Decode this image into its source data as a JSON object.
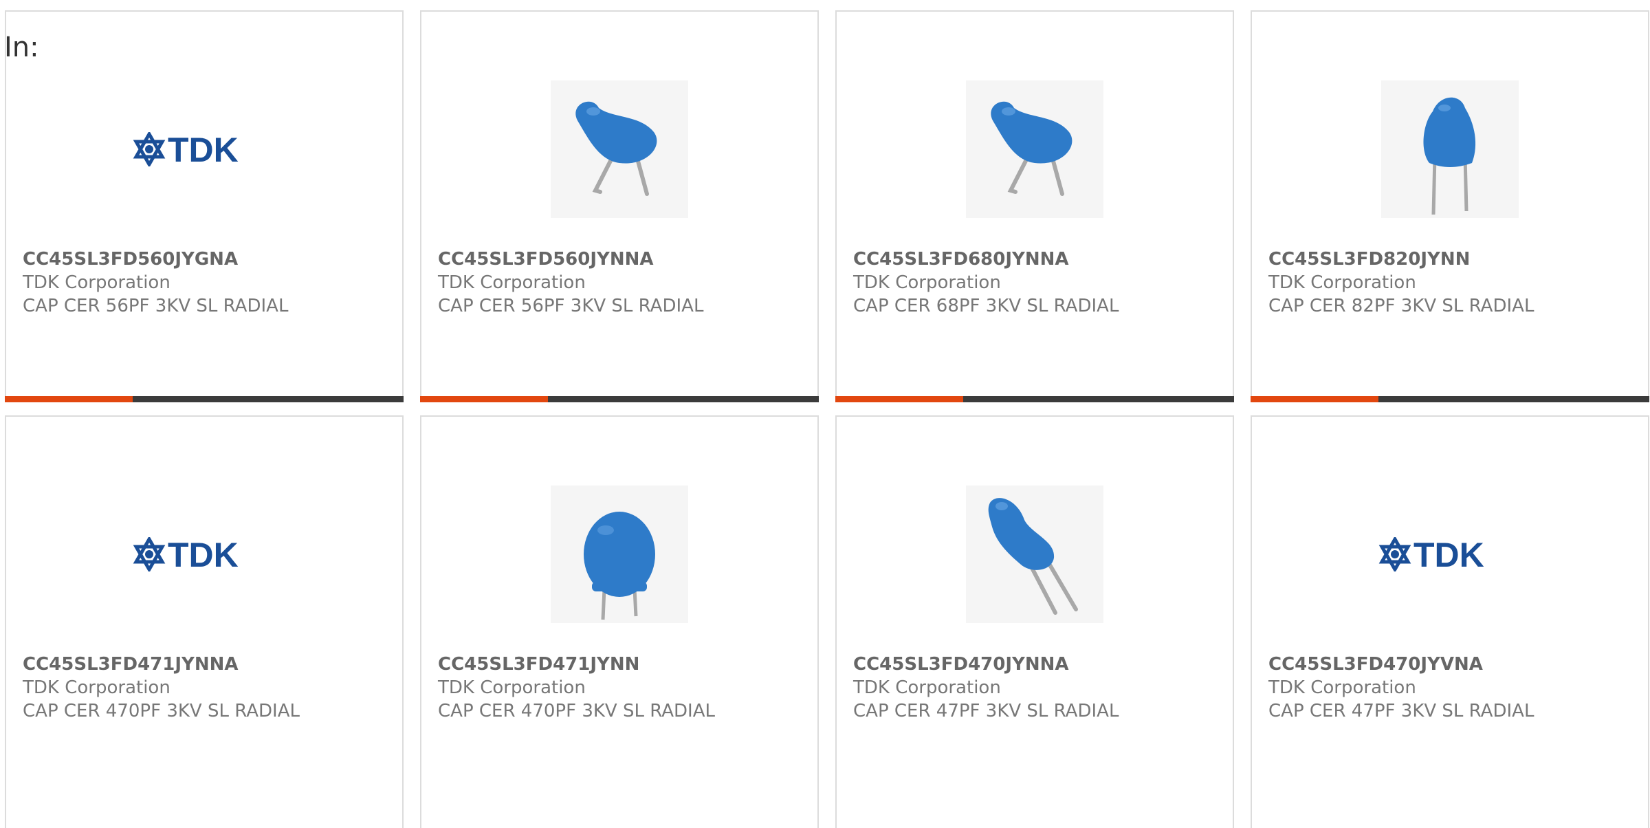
{
  "header": {
    "label": "In:"
  },
  "colors": {
    "accent": "#e2470f",
    "bar": "#3b3b3b",
    "capacitor_blue": "#2e7bc9",
    "logo_blue": "#1a4e97"
  },
  "products": [
    {
      "part": "CC45SL3FD560JYGNA",
      "mfr": "TDK Corporation",
      "desc": "CAP CER 56PF 3KV SL RADIAL",
      "image": "tdk-logo",
      "progress": 0.32
    },
    {
      "part": "CC45SL3FD560JYNNA",
      "mfr": "TDK Corporation",
      "desc": "CAP CER 56PF 3KV SL RADIAL",
      "image": "capacitor-bent-lead-icon",
      "progress": 0.32
    },
    {
      "part": "CC45SL3FD680JYNNA",
      "mfr": "TDK Corporation",
      "desc": "CAP CER 68PF 3KV SL RADIAL",
      "image": "capacitor-bent-lead-icon",
      "progress": 0.32
    },
    {
      "part": "CC45SL3FD820JYNN",
      "mfr": "TDK Corporation",
      "desc": "CAP CER 82PF 3KV SL RADIAL",
      "image": "capacitor-straight-lead-icon",
      "progress": 0.32
    },
    {
      "part": "CC45SL3FD471JYNNA",
      "mfr": "TDK Corporation",
      "desc": "CAP CER 470PF 3KV SL RADIAL",
      "image": "tdk-logo",
      "progress": 0.32
    },
    {
      "part": "CC45SL3FD471JYNN",
      "mfr": "TDK Corporation",
      "desc": "CAP CER 470PF 3KV SL RADIAL",
      "image": "capacitor-disc-icon",
      "progress": 0.32
    },
    {
      "part": "CC45SL3FD470JYNNA",
      "mfr": "TDK Corporation",
      "desc": "CAP CER 47PF 3KV SL RADIAL",
      "image": "capacitor-bent-lead-icon",
      "progress": 0.32
    },
    {
      "part": "CC45SL3FD470JYVNA",
      "mfr": "TDK Corporation",
      "desc": "CAP CER 47PF 3KV SL RADIAL",
      "image": "tdk-logo",
      "progress": 0.32
    }
  ],
  "logo_text": "TDK"
}
